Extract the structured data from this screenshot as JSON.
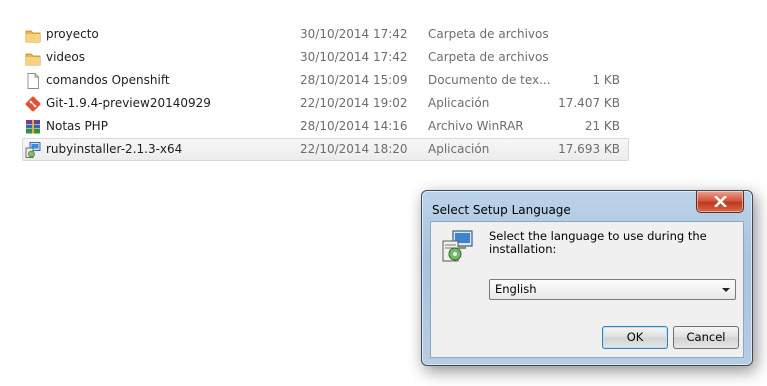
{
  "files": [
    {
      "name": "proyecto",
      "date": "30/10/2014 17:42",
      "type": "Carpeta de archivos",
      "size": "",
      "icon": "folder-icon",
      "selected": false
    },
    {
      "name": "videos",
      "date": "30/10/2014 17:42",
      "type": "Carpeta de archivos",
      "size": "",
      "icon": "folder-icon",
      "selected": false
    },
    {
      "name": "comandos Openshift",
      "date": "28/10/2014 15:09",
      "type": "Documento de tex...",
      "size": "1 KB",
      "icon": "text-document-icon",
      "selected": false
    },
    {
      "name": "Git-1.9.4-preview20140929",
      "date": "22/10/2014 19:02",
      "type": "Aplicación",
      "size": "17.407 KB",
      "icon": "git-icon",
      "selected": false
    },
    {
      "name": "Notas PHP",
      "date": "28/10/2014 14:16",
      "type": "Archivo WinRAR",
      "size": "21 KB",
      "icon": "winrar-icon",
      "selected": false
    },
    {
      "name": "rubyinstaller-2.1.3-x64",
      "date": "22/10/2014 18:20",
      "type": "Aplicación",
      "size": "17.693 KB",
      "icon": "installer-icon",
      "selected": true
    }
  ],
  "dialog": {
    "title": "Select Setup Language",
    "prompt": "Select the language to use during the installation:",
    "language": {
      "selected": "English"
    },
    "ok_label": "OK",
    "cancel_label": "Cancel",
    "icons": {
      "close": "close-icon",
      "setup": "setup-icon",
      "dropdown": "chevron-down-icon"
    }
  },
  "colors": {
    "close_button": "#c7442a",
    "dialog_frame": "#b4cbe3",
    "selected_row": "#efefef"
  }
}
